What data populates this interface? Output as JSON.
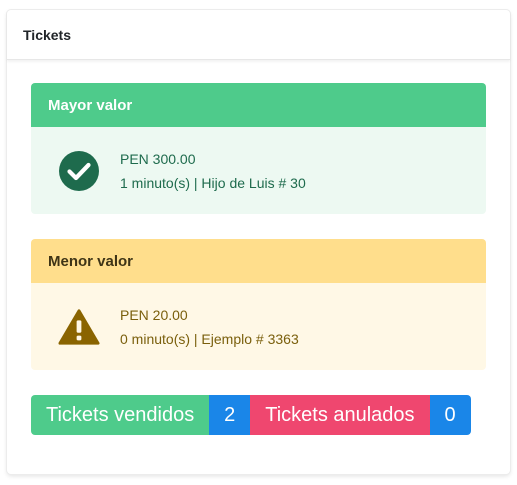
{
  "card": {
    "title": "Tickets"
  },
  "highest": {
    "header": "Mayor valor",
    "amount": "PEN 300.00",
    "detail": "1 minuto(s) | Hijo de Luis # 30",
    "icon": "check-circle-icon",
    "color": "#4ecb8b"
  },
  "lowest": {
    "header": "Menor valor",
    "amount": "PEN 20.00",
    "detail": "0 minuto(s) | Ejemplo # 3363",
    "icon": "warning-triangle-icon",
    "color": "#ffde8c"
  },
  "stats": {
    "sold_label": "Tickets vendidos",
    "sold_count": "2",
    "void_label": "Tickets anulados",
    "void_count": "0"
  }
}
